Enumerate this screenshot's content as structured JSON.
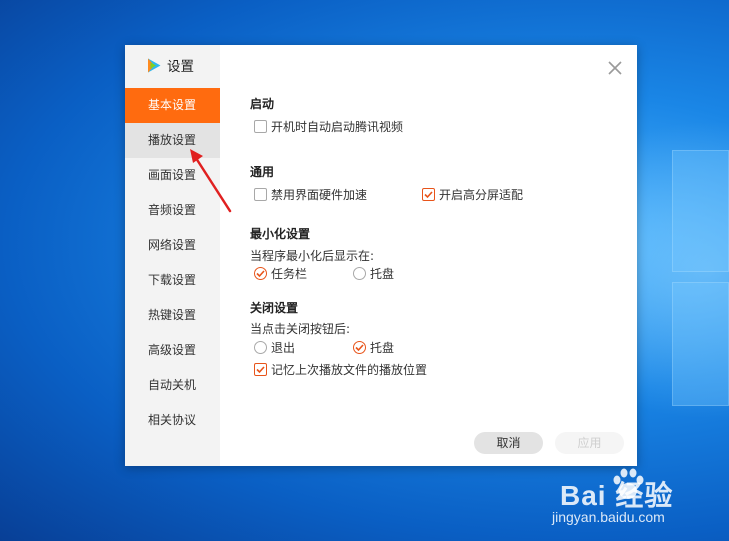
{
  "window": {
    "title": "设置",
    "close_label": "close"
  },
  "sidebar": {
    "items": [
      {
        "label": "基本设置",
        "state": "active"
      },
      {
        "label": "播放设置",
        "state": "hover"
      },
      {
        "label": "画面设置",
        "state": "normal"
      },
      {
        "label": "音频设置",
        "state": "normal"
      },
      {
        "label": "网络设置",
        "state": "normal"
      },
      {
        "label": "下载设置",
        "state": "normal"
      },
      {
        "label": "热键设置",
        "state": "normal"
      },
      {
        "label": "高级设置",
        "state": "normal"
      },
      {
        "label": "自动关机",
        "state": "normal"
      },
      {
        "label": "相关协议",
        "state": "normal"
      }
    ]
  },
  "sections": {
    "startup": {
      "title": "启动",
      "autostart": {
        "label": "开机时自动启动腾讯视频",
        "checked": false
      }
    },
    "general": {
      "title": "通用",
      "disable_hw_accel": {
        "label": "禁用界面硬件加速",
        "checked": false
      },
      "high_dpi": {
        "label": "开启高分屏适配",
        "checked": true
      }
    },
    "minimize": {
      "title": "最小化设置",
      "prompt": "当程序最小化后显示在:",
      "taskbar": {
        "label": "任务栏",
        "selected": true
      },
      "tray": {
        "label": "托盘",
        "selected": false
      }
    },
    "close": {
      "title": "关闭设置",
      "prompt": "当点击关闭按钮后:",
      "exit": {
        "label": "退出",
        "selected": false
      },
      "tray": {
        "label": "托盘",
        "selected": true
      },
      "remember_position": {
        "label": "记忆上次播放文件的播放位置",
        "checked": true
      }
    }
  },
  "buttons": {
    "cancel": "取消",
    "apply": "应用"
  },
  "watermark": {
    "brand": "Bai  经验",
    "url": "jingyan.baidu.com"
  },
  "colors": {
    "accent": "#ff6b0f",
    "check": "#e8541a",
    "annotation_arrow": "#e02020"
  }
}
